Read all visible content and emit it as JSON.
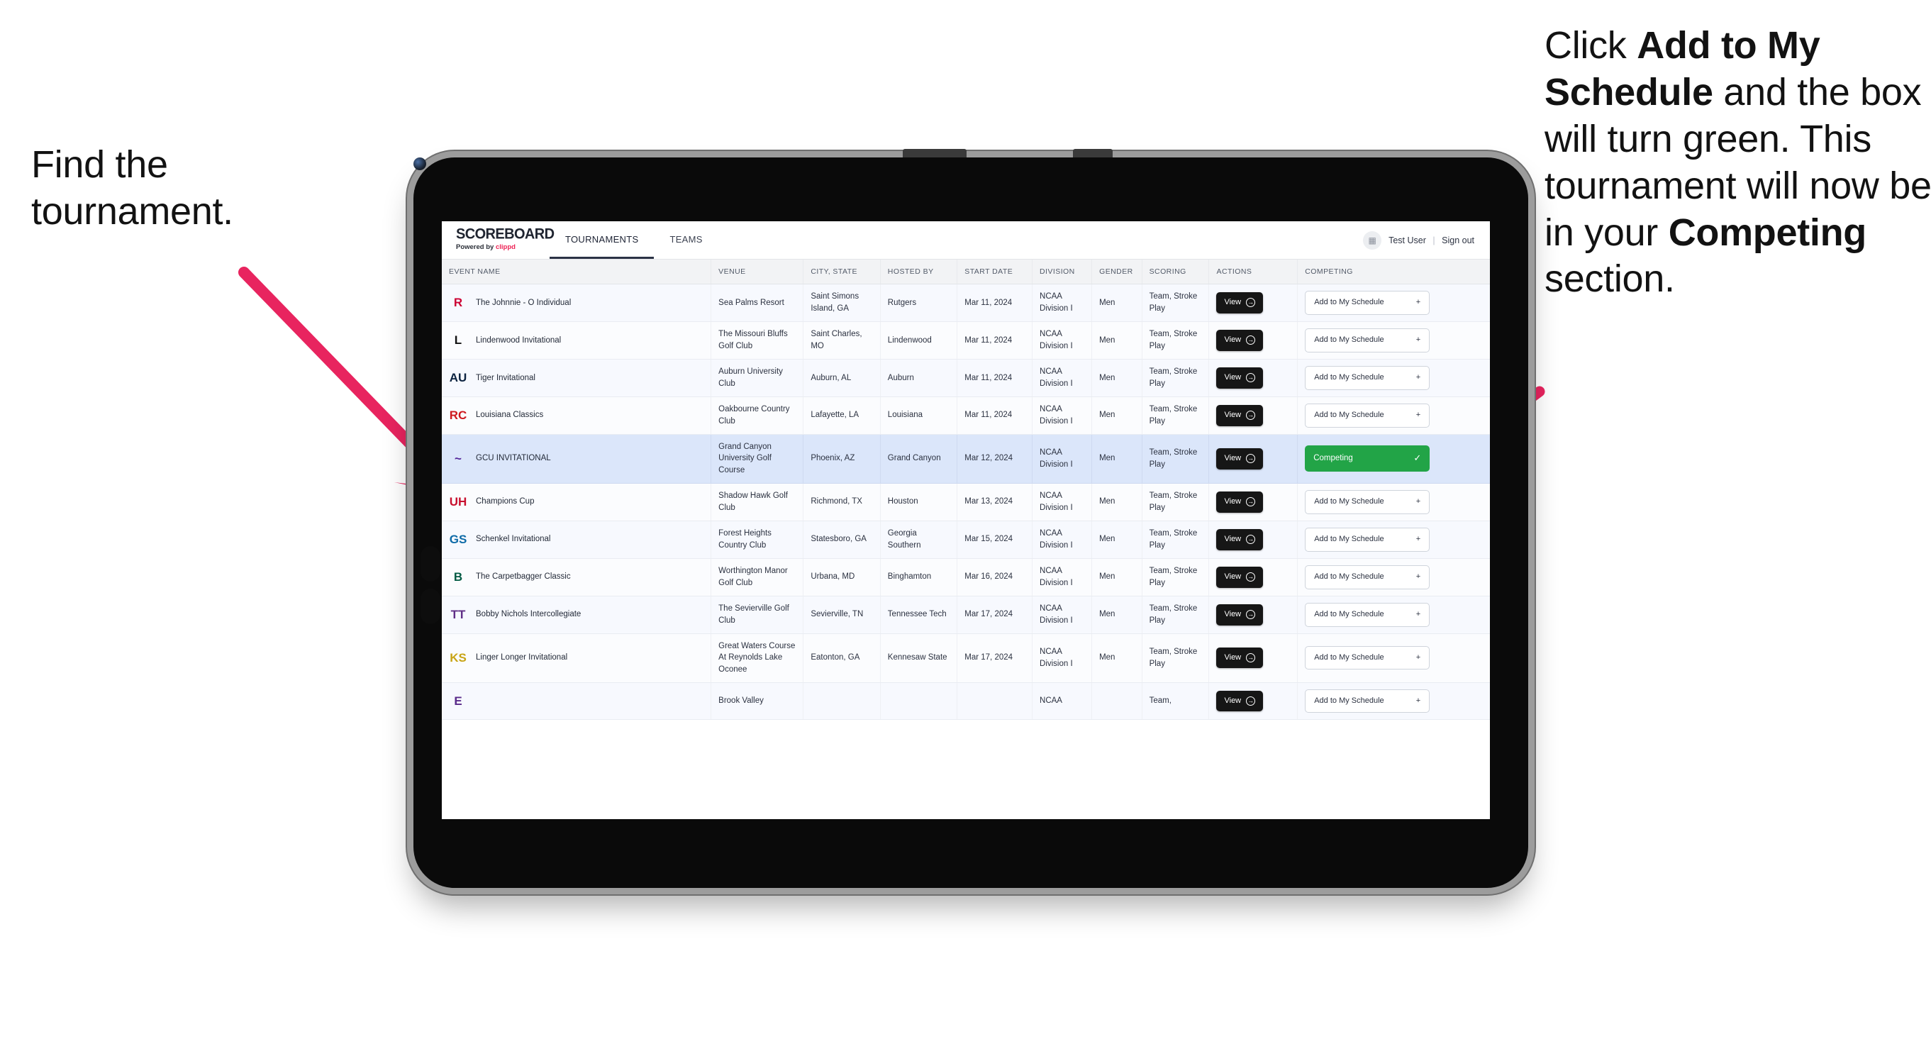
{
  "annotations": {
    "left": {
      "line1": "Find the",
      "line2": "tournament."
    },
    "right": {
      "seg1": "Click ",
      "bold1": "Add to My Schedule",
      "seg2": " and the box will turn green. This tournament will now be in your ",
      "bold2": "Competing",
      "seg3": " section."
    },
    "arrow_color": "#e8245f"
  },
  "app": {
    "brand": {
      "name": "SCOREBOARD",
      "powered_prefix": "Powered by ",
      "powered_brand": "clippd",
      "brand_accent": "#ee2255"
    },
    "nav": [
      {
        "label": "TOURNAMENTS",
        "active": true
      },
      {
        "label": "TEAMS",
        "active": false
      }
    ],
    "account": {
      "avatar_icon": "grid-icon",
      "user": "Test User",
      "separator": "|",
      "signout": "Sign out"
    },
    "table": {
      "columns": [
        "EVENT NAME",
        "VENUE",
        "CITY, STATE",
        "HOSTED BY",
        "START DATE",
        "DIVISION",
        "GENDER",
        "SCORING",
        "ACTIONS",
        "COMPETING"
      ],
      "view_label": "View",
      "add_label": "Add to My Schedule",
      "add_plus": "+",
      "competing_label": "Competing",
      "competing_check": "✓",
      "competing_color": "#22a447",
      "rows": [
        {
          "logo": {
            "text": "R",
            "color": "#cc0033",
            "bg": "transparent"
          },
          "event": "The Johnnie - O Individual",
          "venue": "Sea Palms Resort",
          "city": "Saint Simons Island, GA",
          "host": "Rutgers",
          "date": "Mar 11, 2024",
          "division": "NCAA Division I",
          "gender": "Men",
          "scoring": "Team, Stroke Play",
          "competing": false
        },
        {
          "logo": {
            "text": "L",
            "color": "#111111",
            "bg": "transparent"
          },
          "event": "Lindenwood Invitational",
          "venue": "The Missouri Bluffs Golf Club",
          "city": "Saint Charles, MO",
          "host": "Lindenwood",
          "date": "Mar 11, 2024",
          "division": "NCAA Division I",
          "gender": "Men",
          "scoring": "Team, Stroke Play",
          "competing": false
        },
        {
          "logo": {
            "text": "AU",
            "color": "#0c2340",
            "bg": "transparent"
          },
          "event": "Tiger Invitational",
          "venue": "Auburn University Club",
          "city": "Auburn, AL",
          "host": "Auburn",
          "date": "Mar 11, 2024",
          "division": "NCAA Division I",
          "gender": "Men",
          "scoring": "Team, Stroke Play",
          "competing": false
        },
        {
          "logo": {
            "text": "RC",
            "color": "#ce181e",
            "bg": "transparent"
          },
          "event": "Louisiana Classics",
          "venue": "Oakbourne Country Club",
          "city": "Lafayette, LA",
          "host": "Louisiana",
          "date": "Mar 11, 2024",
          "division": "NCAA Division I",
          "gender": "Men",
          "scoring": "Team, Stroke Play",
          "competing": false
        },
        {
          "logo": {
            "text": "~",
            "color": "#522398",
            "bg": "transparent"
          },
          "event": "GCU INVITATIONAL",
          "venue": "Grand Canyon University Golf Course",
          "city": "Phoenix, AZ",
          "host": "Grand Canyon",
          "date": "Mar 12, 2024",
          "division": "NCAA Division I",
          "gender": "Men",
          "scoring": "Team, Stroke Play",
          "competing": true,
          "selected": true
        },
        {
          "logo": {
            "text": "UH",
            "color": "#c8102e",
            "bg": "transparent"
          },
          "event": "Champions Cup",
          "venue": "Shadow Hawk Golf Club",
          "city": "Richmond, TX",
          "host": "Houston",
          "date": "Mar 13, 2024",
          "division": "NCAA Division I",
          "gender": "Men",
          "scoring": "Team, Stroke Play",
          "competing": false
        },
        {
          "logo": {
            "text": "GS",
            "color": "#0d6aa7",
            "bg": "transparent"
          },
          "event": "Schenkel Invitational",
          "venue": "Forest Heights Country Club",
          "city": "Statesboro, GA",
          "host": "Georgia Southern",
          "date": "Mar 15, 2024",
          "division": "NCAA Division I",
          "gender": "Men",
          "scoring": "Team, Stroke Play",
          "competing": false
        },
        {
          "logo": {
            "text": "B",
            "color": "#005a43",
            "bg": "transparent"
          },
          "event": "The Carpetbagger Classic",
          "venue": "Worthington Manor Golf Club",
          "city": "Urbana, MD",
          "host": "Binghamton",
          "date": "Mar 16, 2024",
          "division": "NCAA Division I",
          "gender": "Men",
          "scoring": "Team, Stroke Play",
          "competing": false
        },
        {
          "logo": {
            "text": "TT",
            "color": "#602f86",
            "bg": "transparent"
          },
          "event": "Bobby Nichols Intercollegiate",
          "venue": "The Sevierville Golf Club",
          "city": "Sevierville, TN",
          "host": "Tennessee Tech",
          "date": "Mar 17, 2024",
          "division": "NCAA Division I",
          "gender": "Men",
          "scoring": "Team, Stroke Play",
          "competing": false
        },
        {
          "logo": {
            "text": "KS",
            "color": "#c8a415",
            "bg": "transparent"
          },
          "event": "Linger Longer Invitational",
          "venue": "Great Waters Course At Reynolds Lake Oconee",
          "city": "Eatonton, GA",
          "host": "Kennesaw State",
          "date": "Mar 17, 2024",
          "division": "NCAA Division I",
          "gender": "Men",
          "scoring": "Team, Stroke Play",
          "competing": false
        },
        {
          "logo": {
            "text": "E",
            "color": "#592a8a",
            "bg": "transparent"
          },
          "event": "",
          "venue": "Brook Valley",
          "city": "",
          "host": "",
          "date": "",
          "division": "NCAA",
          "gender": "",
          "scoring": "Team,",
          "competing": false,
          "partial": true
        }
      ]
    }
  }
}
